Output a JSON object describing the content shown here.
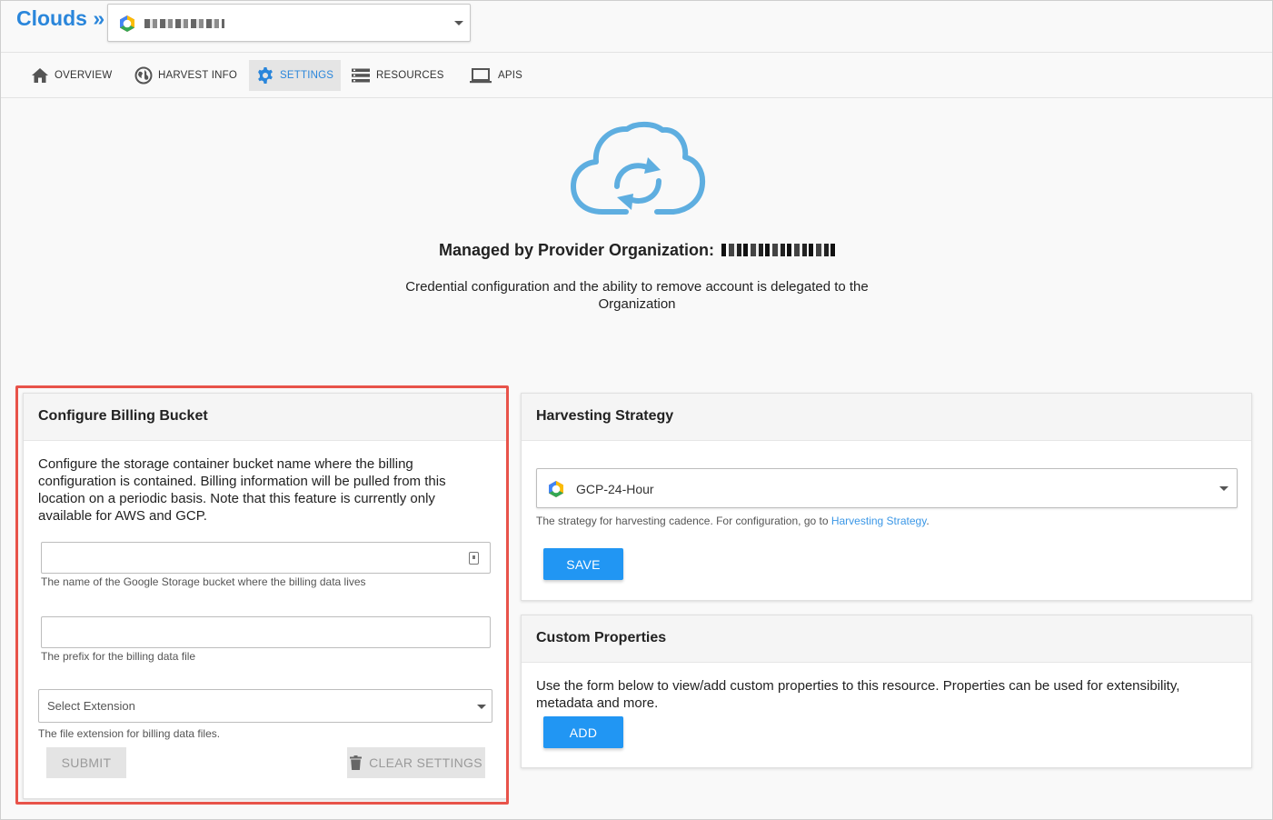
{
  "header": {
    "brand": "Clouds »",
    "cloud_selector": {
      "icon": "gcp-hexagon-icon",
      "value": "redacted"
    }
  },
  "tabs": [
    {
      "label": "OVERVIEW",
      "icon": "home-icon",
      "active": false
    },
    {
      "label": "HARVEST INFO",
      "icon": "globe-icon",
      "active": false
    },
    {
      "label": "SETTINGS",
      "icon": "gear-icon",
      "active": true
    },
    {
      "label": "RESOURCES",
      "icon": "list-icon",
      "active": false
    },
    {
      "label": "APIS",
      "icon": "laptop-icon",
      "active": false
    }
  ],
  "hero": {
    "icon": "cloud-sync-icon",
    "managed_label": "Managed by Provider Organization:",
    "delegated_text": "Credential configuration and the ability to remove account is delegated to the Organization"
  },
  "billing": {
    "title": "Configure Billing Bucket",
    "description": "Configure the storage container bucket name where the billing configuration is contained. Billing information will be pulled from this location on a periodic basis. Note that this feature is currently only available for AWS and GCP.",
    "bucket_value": "",
    "bucket_help": "The name of the Google Storage bucket where the billing data lives",
    "prefix_value": "",
    "prefix_help": "The prefix for the billing data file",
    "extension_placeholder": "Select Extension",
    "extension_help": "The file extension for billing data files.",
    "submit_label": "SUBMIT",
    "clear_label": "CLEAR SETTINGS"
  },
  "harvesting": {
    "title": "Harvesting Strategy",
    "selected": "GCP-24-Hour",
    "help_prefix": "The strategy for harvesting cadence. For configuration, go to ",
    "help_link": "Harvesting Strategy",
    "help_suffix": ".",
    "save_label": "SAVE"
  },
  "custom_properties": {
    "title": "Custom Properties",
    "description": "Use the form below to view/add custom properties to this resource. Properties can be used for extensibility, metadata and more.",
    "add_label": "ADD"
  },
  "colors": {
    "accent": "#2196f3",
    "brand": "#2a86db",
    "highlight": "#e8534a",
    "cloud_icon": "#5eaee0"
  }
}
